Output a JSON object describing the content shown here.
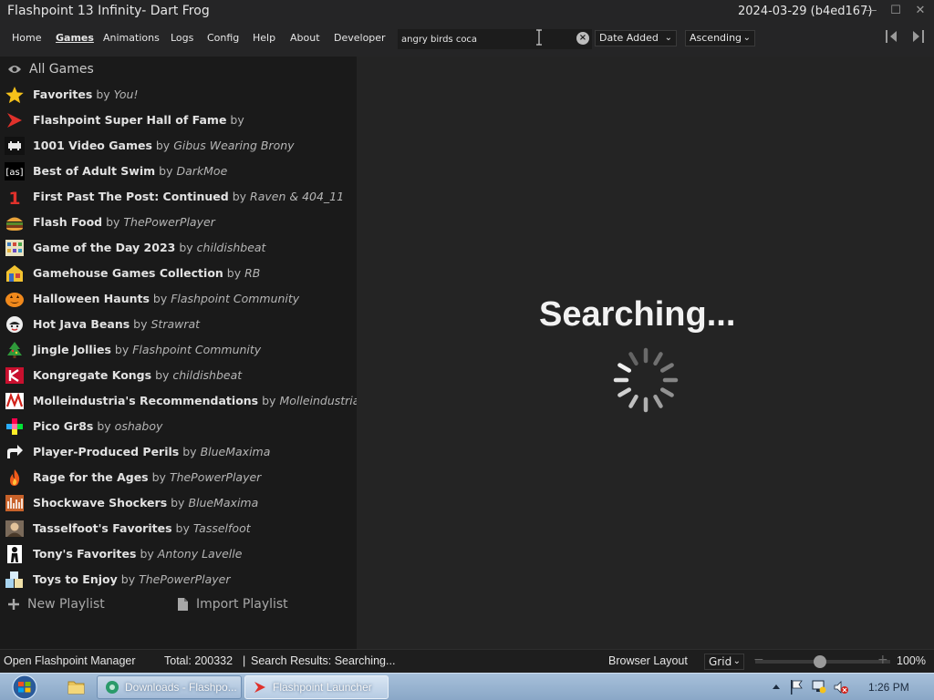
{
  "window": {
    "title": "Flashpoint 13 Infinity- Dart Frog",
    "version": "2024-03-29 (b4ed167)",
    "controls": {
      "minimize": "—",
      "maximize": "☐",
      "close": "✕"
    }
  },
  "menu": {
    "items": [
      {
        "label": "Home"
      },
      {
        "label": "Games",
        "active": true
      },
      {
        "label": "Animations"
      },
      {
        "label": "Logs"
      },
      {
        "label": "Config"
      },
      {
        "label": "Help"
      },
      {
        "label": "About"
      },
      {
        "label": "Developer"
      }
    ]
  },
  "search": {
    "value": "angry birds coca",
    "placeholder": ""
  },
  "sort": {
    "field": "Date Added",
    "order": "Ascending"
  },
  "sidebar": {
    "all_games_label": "All Games",
    "playlists": [
      {
        "name": "Favorites",
        "by": "by",
        "author": "You!",
        "icon": "star-icon"
      },
      {
        "name": "Flashpoint Super Hall of Fame",
        "by": "by",
        "author": "",
        "icon": "flashpoint-icon"
      },
      {
        "name": "1001 Video Games",
        "by": "by",
        "author": "Gibus Wearing Brony",
        "icon": "space-invader-icon"
      },
      {
        "name": "Best of Adult Swim",
        "by": "by",
        "author": "DarkMoe",
        "icon": "adult-swim-icon"
      },
      {
        "name": "First Past The Post: Continued",
        "by": "by",
        "author": "Raven & 404_11",
        "icon": "number-one-icon"
      },
      {
        "name": "Flash Food",
        "by": "by",
        "author": "ThePowerPlayer",
        "icon": "burger-icon"
      },
      {
        "name": "Game of the Day 2023",
        "by": "by",
        "author": "childishbeat",
        "icon": "calendar-icon"
      },
      {
        "name": "Gamehouse Games Collection",
        "by": "by",
        "author": "RB",
        "icon": "gamehouse-icon"
      },
      {
        "name": "Halloween Haunts",
        "by": "by",
        "author": "Flashpoint Community",
        "icon": "pumpkin-icon"
      },
      {
        "name": "Hot Java Beans",
        "by": "by",
        "author": "Strawrat",
        "icon": "coffee-icon"
      },
      {
        "name": "Jingle Jollies",
        "by": "by",
        "author": "Flashpoint Community",
        "icon": "christmas-tree-icon"
      },
      {
        "name": "Kongregate Kongs",
        "by": "by",
        "author": "childishbeat",
        "icon": "kongregate-icon"
      },
      {
        "name": "Molleindustria's Recommendations",
        "by": "by",
        "author": "Molleindustria",
        "icon": "molleindustria-icon"
      },
      {
        "name": "Pico Gr8s",
        "by": "by",
        "author": "oshaboy",
        "icon": "pico-icon"
      },
      {
        "name": "Player-Produced Perils",
        "by": "by",
        "author": "BlueMaxima",
        "icon": "share-arrow-icon"
      },
      {
        "name": "Rage for the Ages",
        "by": "by",
        "author": "ThePowerPlayer",
        "icon": "flame-icon"
      },
      {
        "name": "Shockwave Shockers",
        "by": "by",
        "author": "BlueMaxima",
        "icon": "shockwave-icon"
      },
      {
        "name": "Tasselfoot's Favorites",
        "by": "by",
        "author": "Tasselfoot",
        "icon": "avatar-icon"
      },
      {
        "name": "Tony's Favorites",
        "by": "by",
        "author": "Antony Lavelle",
        "icon": "silhouette-icon"
      },
      {
        "name": "Toys to Enjoy",
        "by": "by",
        "author": "ThePowerPlayer",
        "icon": "toy-blocks-icon"
      }
    ],
    "new_playlist_label": "New Playlist",
    "import_playlist_label": "Import Playlist"
  },
  "main": {
    "searching_label": "Searching..."
  },
  "status": {
    "open_manager_label": "Open Flashpoint Manager",
    "total": "Total: 200332",
    "separator": "|",
    "search_results": "Search Results: Searching...",
    "browser_layout_label": "Browser Layout",
    "layout_value": "Grid",
    "zoom_value": 0.48,
    "zoom_text": "100%"
  },
  "taskbar": {
    "tasks": [
      {
        "label": "Downloads - Flashpo..."
      },
      {
        "label": "Flashpoint Launcher",
        "active": true
      }
    ],
    "clock": "1:26 PM"
  },
  "colors": {
    "background": "#1e1e1e",
    "sidebar": "#1a1a1a",
    "main": "#242424",
    "taskbar": "#a7c0da",
    "accent_red": "#e0312b"
  }
}
